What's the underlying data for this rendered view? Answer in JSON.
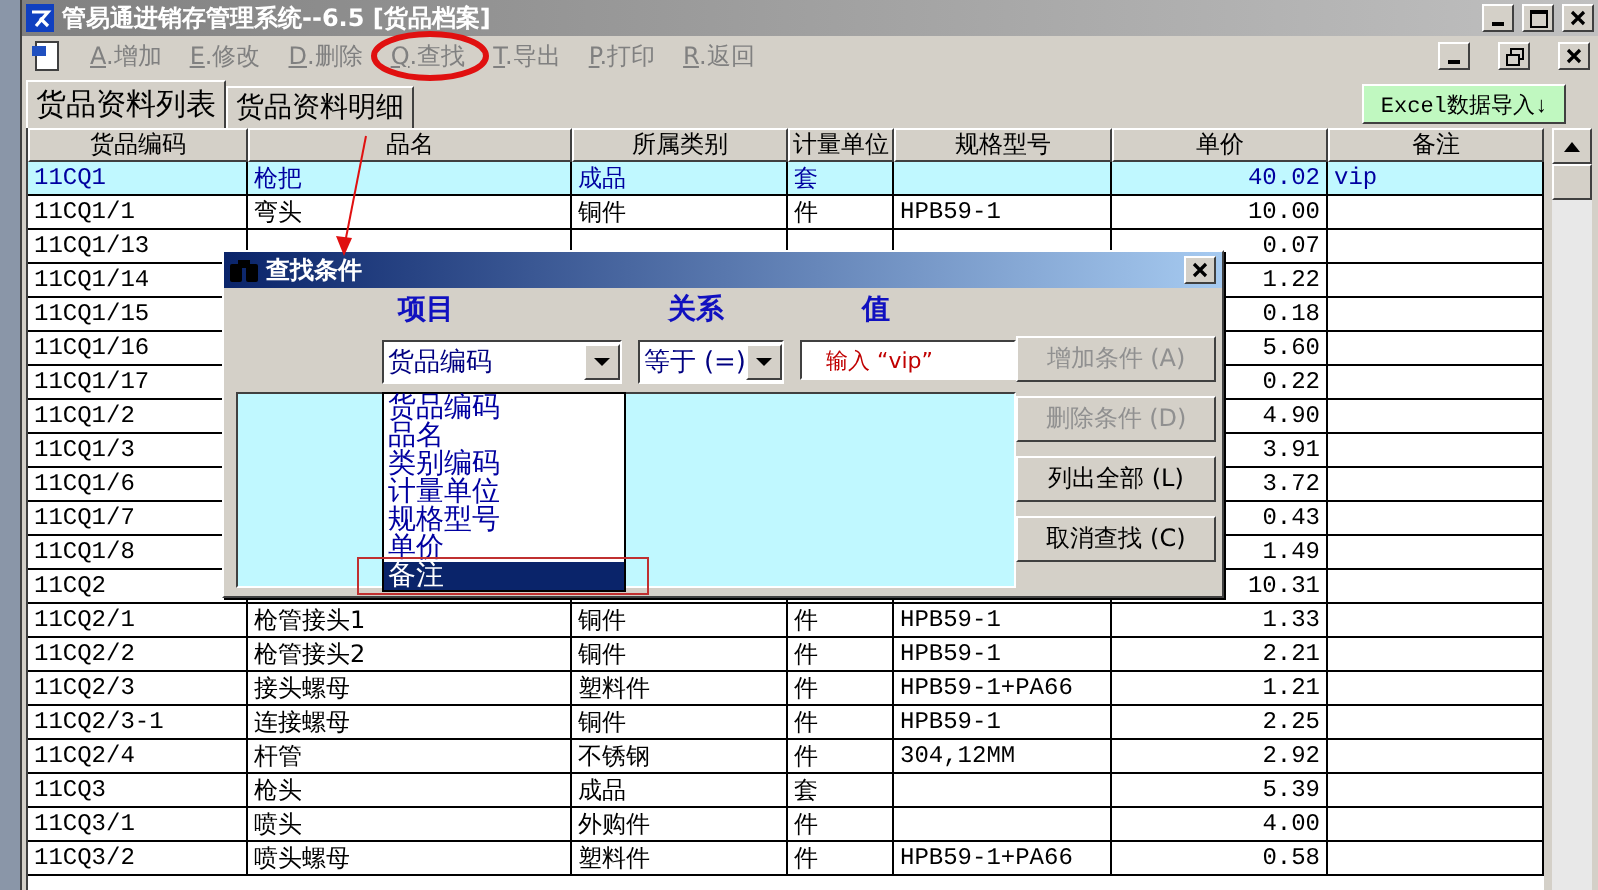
{
  "window": {
    "title": "管易通进销存管理系统--6.5 [货品档案]"
  },
  "toolbar": [
    {
      "hotkey": "A",
      "label": ".增加",
      "circled": false
    },
    {
      "hotkey": "E",
      "label": ".修改",
      "circled": false
    },
    {
      "hotkey": "D",
      "label": ".删除",
      "circled": false
    },
    {
      "hotkey": "Q",
      "label": ".查找",
      "circled": true
    },
    {
      "hotkey": "T",
      "label": ".导出",
      "circled": false
    },
    {
      "hotkey": "P",
      "label": ".打印",
      "circled": false
    },
    {
      "hotkey": "R",
      "label": ".返回",
      "circled": false
    }
  ],
  "tabs": [
    {
      "label": "货品资料列表",
      "selected": true
    },
    {
      "label": "货品资料明细",
      "selected": false
    }
  ],
  "excel_button": "Excel数据导入↓",
  "table": {
    "columns": [
      "货品编码",
      "品名",
      "所属类别",
      "计量单位",
      "规格型号",
      "单价",
      "备注"
    ],
    "rows": [
      {
        "code": "11CQ1",
        "name": "枪把",
        "category": "成品",
        "unit": "套",
        "price": "40.02",
        "note": "vip",
        "selected": true
      },
      {
        "code": "11CQ1/1",
        "name": "弯头",
        "category": "铜件",
        "unit": "件",
        "spec": "HPB59-1",
        "price": "10.00",
        "selected": false
      },
      {
        "code": "11CQ1/13",
        "price": "0.07",
        "selected": false
      },
      {
        "code": "11CQ1/14",
        "price": "1.22",
        "selected": false
      },
      {
        "code": "11CQ1/15",
        "price": "0.18",
        "selected": false
      },
      {
        "code": "11CQ1/16",
        "price": "5.60",
        "selected": false
      },
      {
        "code": "11CQ1/17",
        "price": "0.22",
        "selected": false
      },
      {
        "code": "11CQ1/2",
        "price": "4.90",
        "selected": false
      },
      {
        "code": "11CQ1/3",
        "price": "3.91",
        "selected": false
      },
      {
        "code": "11CQ1/6",
        "price": "3.72",
        "selected": false
      },
      {
        "code": "11CQ1/7",
        "price": "0.43",
        "selected": false
      },
      {
        "code": "11CQ1/8",
        "price": "1.49",
        "selected": false
      },
      {
        "code": "11CQ2",
        "price": "10.31",
        "selected": false
      },
      {
        "code": "11CQ2/1",
        "name": "枪管接头1",
        "category": "铜件",
        "unit": "件",
        "spec": "HPB59-1",
        "price": "1.33",
        "selected": false
      },
      {
        "code": "11CQ2/2",
        "name": "枪管接头2",
        "category": "铜件",
        "unit": "件",
        "spec": "HPB59-1",
        "price": "2.21",
        "selected": false
      },
      {
        "code": "11CQ2/3",
        "name": "接头螺母",
        "category": "塑料件",
        "unit": "件",
        "spec": "HPB59-1+PA66",
        "price": "1.21",
        "selected": false
      },
      {
        "code": "11CQ2/3-1",
        "name": "连接螺母",
        "category": "铜件",
        "unit": "件",
        "spec": "HPB59-1",
        "price": "2.25",
        "selected": false
      },
      {
        "code": "11CQ2/4",
        "name": "杆管",
        "category": "不锈钢",
        "unit": "件",
        "spec": "304,12MM",
        "price": "2.92",
        "selected": false
      },
      {
        "code": "11CQ3",
        "name": "枪头",
        "category": "成品",
        "unit": "套",
        "price": "5.39",
        "selected": false
      },
      {
        "code": "11CQ3/1",
        "name": "喷头",
        "category": "外购件",
        "unit": "件",
        "price": "4.00",
        "selected": false
      },
      {
        "code": "11CQ3/2",
        "name": "喷头螺母",
        "category": "塑料件",
        "unit": "件",
        "spec": "HPB59-1+PA66",
        "price": "0.58",
        "selected": false
      }
    ]
  },
  "dialog": {
    "title": "查找条件",
    "headers": [
      "项目",
      "关系",
      "值"
    ],
    "item_select": {
      "value": "货品编码"
    },
    "options": [
      {
        "label": "货品编码",
        "selected": false
      },
      {
        "label": "品名",
        "selected": false
      },
      {
        "label": "类别编码",
        "selected": false
      },
      {
        "label": "计量单位",
        "selected": false
      },
      {
        "label": "规格型号",
        "selected": false
      },
      {
        "label": "单价",
        "selected": false
      },
      {
        "label": "备注",
        "selected": true
      }
    ],
    "relation_select": {
      "value": "等于 (=)"
    },
    "value_field": {
      "value": "输入 “vip”"
    },
    "buttons": [
      {
        "label": "增加条件 (A)",
        "disabled": true
      },
      {
        "label": "删除条件 (D)",
        "disabled": true
      },
      {
        "label": "列出全部 (L)",
        "disabled": false
      },
      {
        "label": "取消查找 (C)",
        "disabled": false
      }
    ]
  }
}
